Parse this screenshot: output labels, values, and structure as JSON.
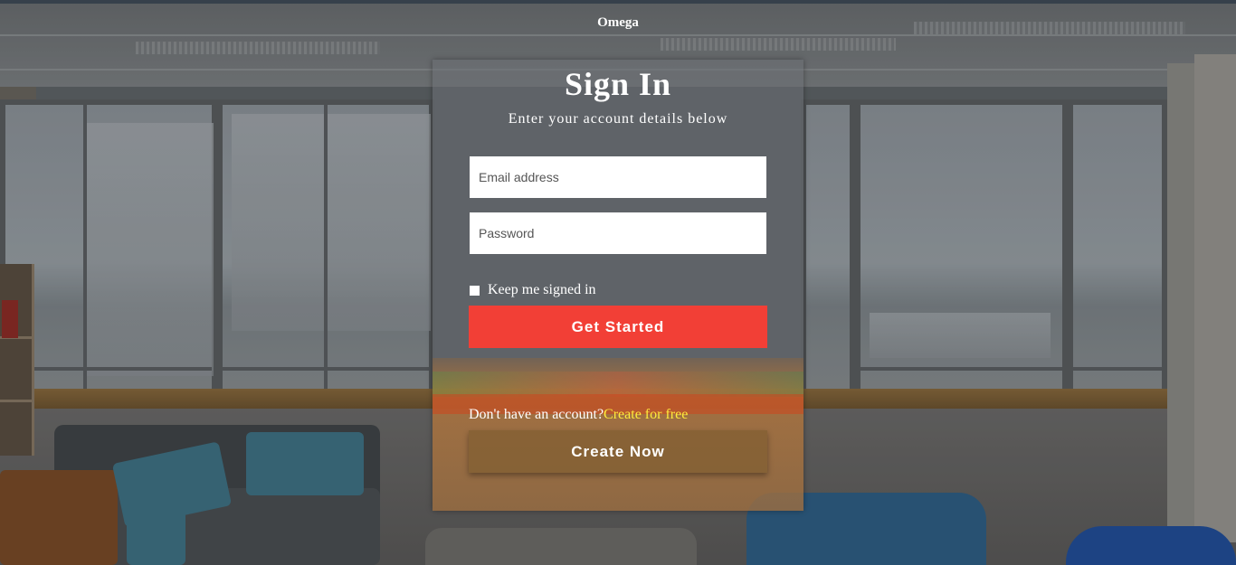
{
  "header": {
    "brand": "Omega"
  },
  "form": {
    "title": "Sign In",
    "subtitle": "Enter your account details below",
    "email_placeholder": "Email address",
    "password_placeholder": "Password",
    "remember_label": "Keep me signed in",
    "submit_label": "Get Started",
    "signup_prompt": "Don't have an account?",
    "signup_link": "Create for free",
    "create_label": "Create Now"
  },
  "colors": {
    "primary_button": "#f23f36",
    "link": "#ffeb3b",
    "text": "#ffffff"
  },
  "icons": [
    "checkbox-icon"
  ]
}
